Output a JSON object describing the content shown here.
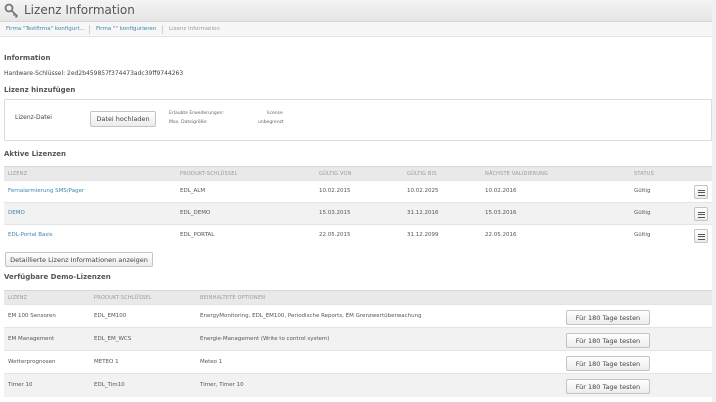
{
  "page": {
    "title": "Lizenz Information",
    "icon": "key-icon"
  },
  "breadcrumb": {
    "items": [
      "Firma \"Testfirma\" konfigurt...",
      "Firma \"\" konfigurieren",
      "Lizenz Information"
    ]
  },
  "information": {
    "heading": "Information",
    "hardware_key": "Hardware-Schlüssel: 2ed2b459857f374473adc39ff9744263"
  },
  "add_license": {
    "heading": "Lizenz hinzufügen",
    "file_label": "Lizenz-Datei",
    "upload_button": "Datei hochladen",
    "allowed_ext_label": "Erlaubte Erweiterungen:",
    "allowed_ext_value": "license",
    "max_size_label": "Max. Dateigröße:",
    "max_size_value": "unbegrenzt"
  },
  "active_licenses": {
    "heading": "Aktive Lizenzen",
    "columns": [
      "LIZENZ",
      "PRODUKT-SCHLÜSSEL",
      "GÜLTIG VON",
      "GÜLTIG BIS",
      "NÄCHSTE VALIDIERUNG",
      "STATUS"
    ],
    "rows": [
      {
        "license": "Fernalarmierung SMS/Pager",
        "key": "EDL_ALM",
        "from": "10.02.2015",
        "to": "10.02.2025",
        "next": "10.02.2016",
        "status": "Gültig"
      },
      {
        "license": "DEMO",
        "key": "EDL_DEMO",
        "from": "15.03.2015",
        "to": "31.12.2016",
        "next": "15.03.2016",
        "status": "Gültig"
      },
      {
        "license": "EDL-Portal Basis",
        "key": "EDL_PORTAL",
        "from": "22.05.2015",
        "to": "31.12.2099",
        "next": "22.05.2016",
        "status": "Gültig"
      }
    ],
    "details_button": "Detaillierte Lizenz Informationen anzeigen"
  },
  "demo_licenses": {
    "heading": "Verfügbare Demo-Lizenzen",
    "columns": [
      "LIZENZ",
      "PRODUKT-SCHLÜSSEL",
      "BEINHALTETE OPTIONEN"
    ],
    "test_button": "Für 180 Tage testen",
    "rows": [
      {
        "license": "EM 100 Sensoren",
        "key": "EDL_EM100",
        "options": "EnergyMonitoring, EDL_EM100, Periodische Reports, EM Grenzwertüberwachung"
      },
      {
        "license": "EM Management",
        "key": "EDL_EM_WCS",
        "options": "Energie-Management (Write to control system)"
      },
      {
        "license": "Wetterprognosen",
        "key": "METEO 1",
        "options": "Meteo 1"
      },
      {
        "license": "Timer 10",
        "key": "EDL_Tim10",
        "options": "Timer, Timer 10"
      }
    ]
  }
}
